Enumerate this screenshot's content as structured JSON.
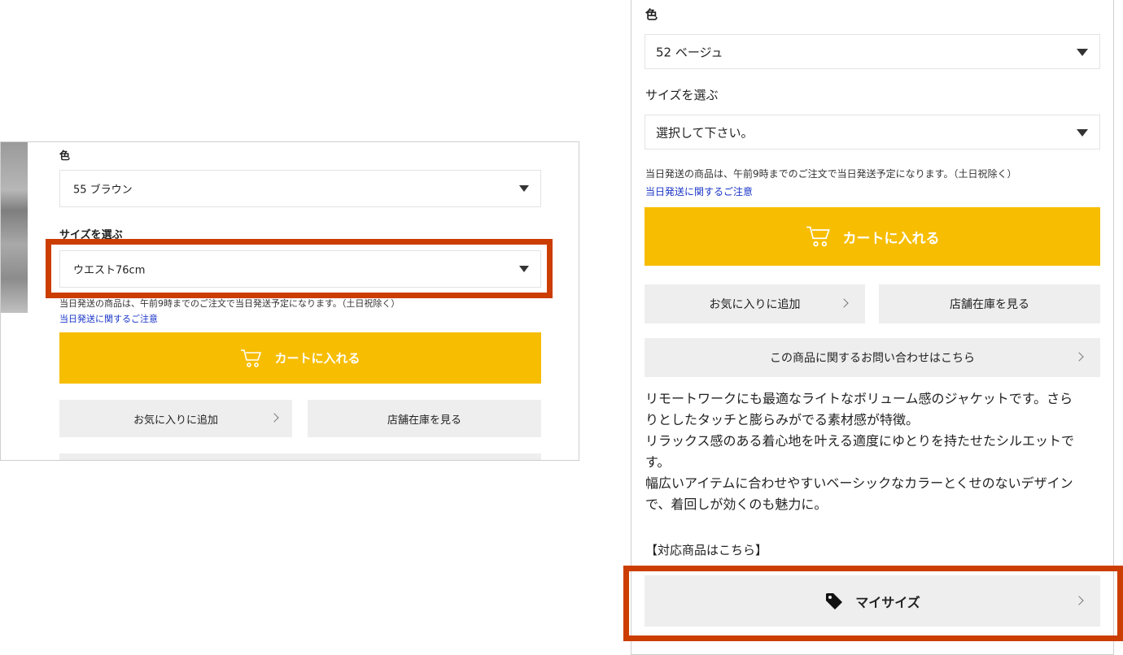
{
  "left": {
    "color_label": "色",
    "color_value": "55 ブラウン",
    "size_label": "サイズを選ぶ",
    "size_value": "ウエスト76cm",
    "shipping_note": "当日発送の商品は、午前9時までのご注文で当日発送予定になります。（土日祝除く）",
    "shipping_link": "当日発送に関するご注意",
    "cart_label": "カートに入れる",
    "favorite_label": "お気に入りに追加",
    "store_stock_label": "店舗在庫を見る"
  },
  "right": {
    "color_label": "色",
    "color_value": "52 ベージュ",
    "size_label": "サイズを選ぶ",
    "size_value": "選択して下さい。",
    "shipping_note": "当日発送の商品は、午前9時までのご注文で当日発送予定になります。（土日祝除く）",
    "shipping_link": "当日発送に関するご注意",
    "cart_label": "カートに入れる",
    "favorite_label": "お気に入りに追加",
    "store_stock_label": "店舗在庫を見る",
    "inquiry_label": "この商品に関するお問い合わせはこちら",
    "description": [
      "リモートワークにも最適なライトなボリューム感のジャケットです。さら",
      "りとしたタッチと膨らみがでる素材感が特徴。",
      "リラックス感のある着心地を叶える適度にゆとりを持たせたシルエットで",
      "す。",
      "幅広いアイテムに合わせやすいベーシックなカラーとくせのないデザイン",
      "で、着回しが効くのも魅力に。"
    ],
    "corresponding_label": "【対応商品はこちら】",
    "mysize_label": "マイサイズ"
  },
  "colors": {
    "accent_yellow": "#f7bd00",
    "highlight_red": "#cc3d00",
    "link_blue": "#1a35c8",
    "button_gray": "#eeeeee"
  },
  "icons": {
    "cart": "cart-icon",
    "tag": "tag-icon",
    "dropdown": "caret-down-icon",
    "chevron": "chevron-right-icon"
  }
}
